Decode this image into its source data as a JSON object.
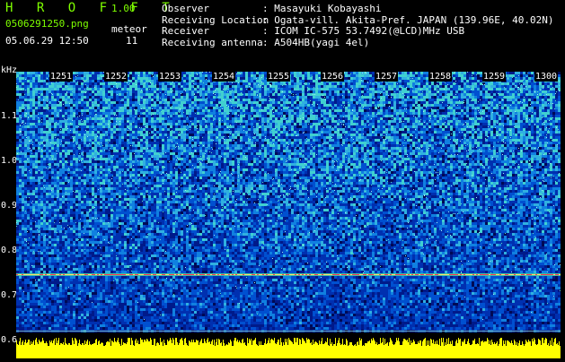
{
  "header": {
    "brand": "H R O F F T",
    "version": "1.00",
    "filename": "0506291250.png",
    "meteor_label": "meteor",
    "datetime": "05.06.29 12:50",
    "meteor_count": "11"
  },
  "info": [
    {
      "key": "Observer",
      "value": ": Masayuki Kobayashi"
    },
    {
      "key": "Receiving Location",
      "value": ": Ogata-vill. Akita-Pref. JAPAN (139.96E, 40.02N)"
    },
    {
      "key": "Receiver",
      "value": ": ICOM IC-575 53.7492(@LCD)MHz USB"
    },
    {
      "key": "Receiving antenna",
      "value": ": A504HB(yagi 4el)"
    }
  ],
  "axis": {
    "unit": "kHz",
    "y_ticks": [
      "1.1",
      "1.0",
      "0.9",
      "0.8",
      "0.7",
      "0.6"
    ],
    "time_ticks": [
      "1251",
      "1252",
      "1253",
      "1254",
      "1255",
      "1256",
      "1257",
      "1258",
      "1259",
      "1300"
    ]
  },
  "colors": {
    "background": "#000000",
    "spectrum_low": "#00107a",
    "spectrum_high": "#33cccc",
    "signal_line": "#ff3355",
    "histogram": "#ffff00",
    "title": "#7fff00"
  }
}
